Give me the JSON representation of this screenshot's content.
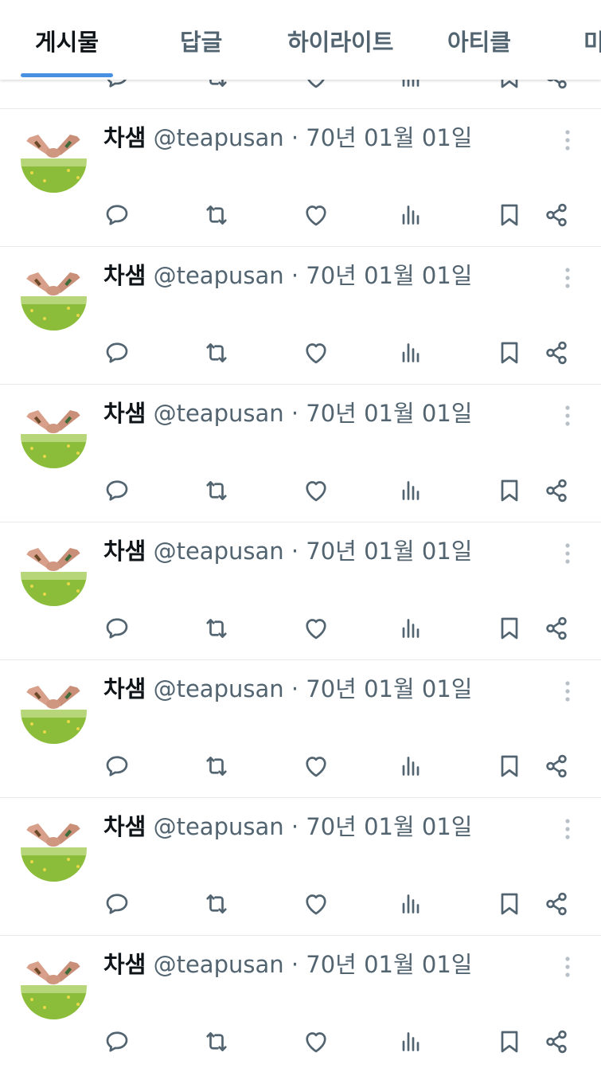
{
  "tabs": [
    "게시물",
    "답글",
    "하이라이트",
    "아티클",
    "미"
  ],
  "colors": {
    "accent": "#4a90e2",
    "text_primary": "#0f1419",
    "text_secondary": "#536471",
    "divider": "#e7e9eb"
  },
  "posts": [
    {
      "name": "차샘",
      "handle": "@teapusan",
      "dot": "·",
      "date": "70년 01월 01일"
    },
    {
      "name": "차샘",
      "handle": "@teapusan",
      "dot": "·",
      "date": "70년 01월 01일"
    },
    {
      "name": "차샘",
      "handle": "@teapusan",
      "dot": "·",
      "date": "70년 01월 01일"
    },
    {
      "name": "차샘",
      "handle": "@teapusan",
      "dot": "·",
      "date": "70년 01월 01일"
    },
    {
      "name": "차샘",
      "handle": "@teapusan",
      "dot": "·",
      "date": "70년 01월 01일"
    },
    {
      "name": "차샘",
      "handle": "@teapusan",
      "dot": "·",
      "date": "70년 01월 01일"
    },
    {
      "name": "차샘",
      "handle": "@teapusan",
      "dot": "·",
      "date": "70년 01월 01일"
    }
  ],
  "action_icons": [
    "reply-icon",
    "repost-icon",
    "like-icon",
    "views-icon",
    "bookmark-icon",
    "share-icon"
  ]
}
